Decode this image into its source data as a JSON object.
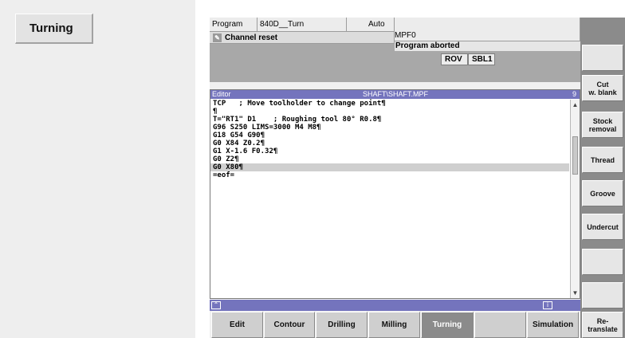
{
  "left": {
    "turning_key": "Turning"
  },
  "header": {
    "program_label": "Program",
    "machine_name": "840D__Turn",
    "mode": "Auto",
    "program_name": "MPF0",
    "channel_status": "Channel reset",
    "program_status": "Program aborted",
    "rov": "ROV",
    "sbl": "SBL1"
  },
  "editor": {
    "title": "Editor",
    "path": "SHAFT\\SHAFT.MPF",
    "number": "9",
    "lines": [
      "TCP   ; Move toolholder to change point¶",
      "¶",
      "T=\"RT1\" D1    ; Roughing tool 80° R0.8¶",
      "G96 S250 LIMS=3000 M4 M8¶",
      "G18 G54 G90¶",
      "G0 X84 Z0.2¶",
      "G1 X-1.6 F0.32¶",
      "G0 Z2¶",
      "G0 X80¶",
      "=eof="
    ]
  },
  "lower_band": {
    "collapse_icon": "chevron-up-icon",
    "info_icon": "i"
  },
  "horizontal_softkeys": [
    {
      "label": "Edit"
    },
    {
      "label": "Contour"
    },
    {
      "label": "Drilling"
    },
    {
      "label": "Milling"
    },
    {
      "label": "Turning"
    },
    {
      "label": ""
    },
    {
      "label": "Simulation"
    },
    {
      "label": "Re-\ntranslate"
    }
  ],
  "vertical_softkeys": [
    {
      "label": ""
    },
    {
      "label": "Cut\nw. blank"
    },
    {
      "label": "Stock\nremoval"
    },
    {
      "label": "Thread"
    },
    {
      "label": "Groove"
    },
    {
      "label": "Undercut"
    },
    {
      "label": ""
    },
    {
      "label": ""
    }
  ],
  "colors": {
    "title_bar": "#7474bd",
    "active_softkey": "#8b8b8b",
    "status_band": "#a8a8a8"
  }
}
